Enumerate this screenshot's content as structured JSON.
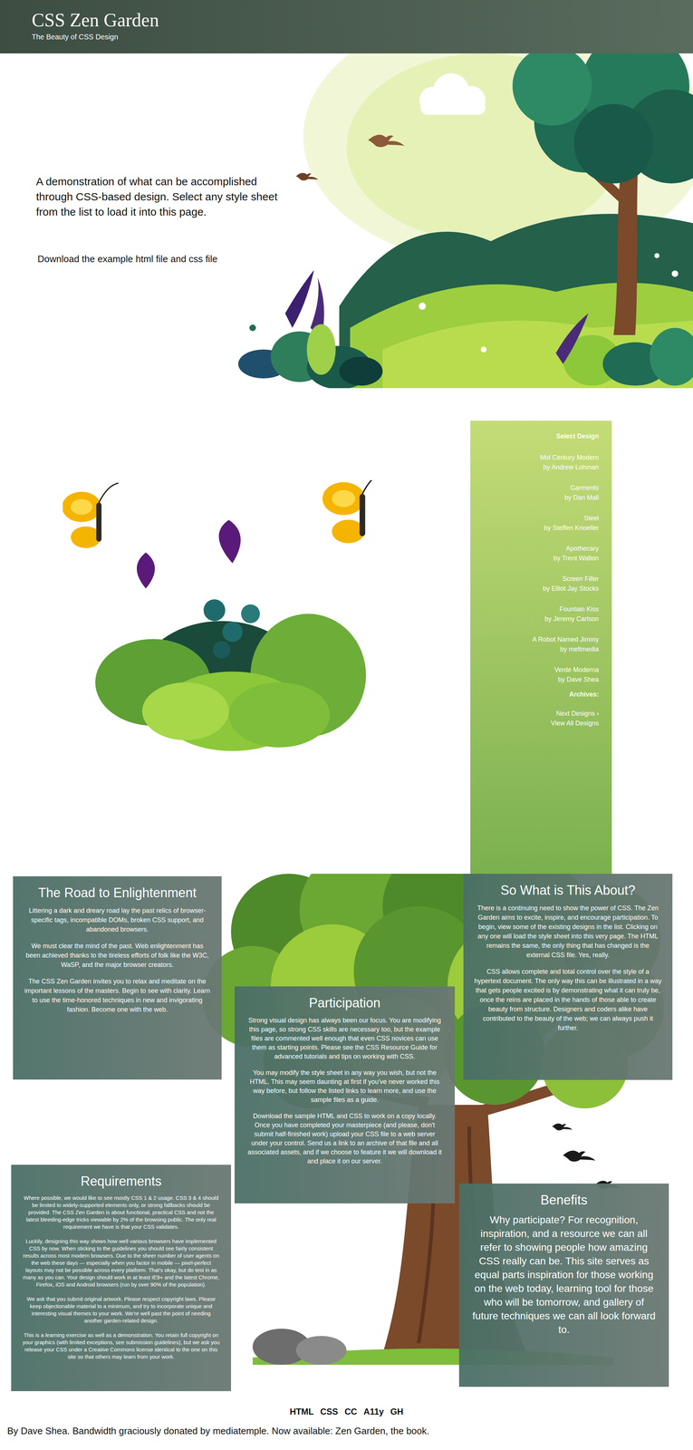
{
  "header": {
    "title": "CSS Zen Garden",
    "subtitle": "The Beauty of CSS Design"
  },
  "intro": {
    "text": "A demonstration of what can be accomplished through CSS-based design. Select any style sheet from the list to load it into this page.",
    "download": "Download the example html file and css file"
  },
  "sidebar": {
    "heading": "Select Design",
    "designs": [
      {
        "name": "Mid Century Modern",
        "author": "by Andrew Lohman"
      },
      {
        "name": "Garments",
        "author": "by Dan Mall"
      },
      {
        "name": "Steel",
        "author": "by Steffen Knoeller"
      },
      {
        "name": "Apothecary",
        "author": "by Trent Walton"
      },
      {
        "name": "Screen Filler",
        "author": "by Elliot Jay Stocks"
      },
      {
        "name": "Fountain Kiss",
        "author": "by Jeremy Carlson"
      },
      {
        "name": "A Robot Named Jimmy",
        "author": "by meltmedia"
      },
      {
        "name": "Verde Moderna",
        "author": "by Dave Shea"
      }
    ],
    "archives_heading": "Archives:",
    "archive_links": [
      "Next Designs ›",
      "View All Designs"
    ]
  },
  "sections": [
    {
      "title": "The Road to Enlightenment",
      "paragraphs": [
        "Littering a dark and dreary road lay the past relics of browser-specific tags, incompatible DOMs, broken CSS support, and abandoned browsers.",
        "We must clear the mind of the past. Web enlightenment has been achieved thanks to the tireless efforts of folk like the W3C, WaSP, and the major browser creators.",
        "The CSS Zen Garden invites you to relax and meditate on the important lessons of the masters. Begin to see with clarity. Learn to use the time-honored techniques in new and invigorating fashion. Become one with the web."
      ]
    },
    {
      "title": "So What is This About?",
      "paragraphs": [
        "There is a continuing need to show the power of CSS. The Zen Garden aims to excite, inspire, and encourage participation. To begin, view some of the existing designs in the list. Clicking on any one will load the style sheet into this very page. The HTML remains the same, the only thing that has changed is the external CSS file. Yes, really.",
        "CSS allows complete and total control over the style of a hypertext document. The only way this can be illustrated in a way that gets people excited is by demonstrating what it can truly be, once the reins are placed in the hands of those able to create beauty from structure. Designers and coders alike have contributed to the beauty of the web; we can always push it further."
      ]
    },
    {
      "title": "Participation",
      "paragraphs": [
        "Strong visual design has always been our focus. You are modifying this page, so strong CSS skills are necessary too, but the example files are commented well enough that even CSS novices can use them as starting points. Please see the CSS Resource Guide for advanced tutorials and tips on working with CSS.",
        "You may modify the style sheet in any way you wish, but not the HTML. This may seem daunting at first if you've never worked this way before, but follow the listed links to learn more, and use the sample files as a guide.",
        "Download the sample HTML and CSS to work on a copy locally. Once you have completed your masterpiece (and please, don't submit half-finished work) upload your CSS file to a web server under your control. Send us a link to an archive of that file and all associated assets, and if we choose to feature it we will download it and place it on our server."
      ]
    },
    {
      "title": "Requirements",
      "paragraphs": [
        "Where possible, we would like to see mostly CSS 1 & 2 usage. CSS 3 & 4 should be limited to widely-supported elements only, or strong fallbacks should be provided. The CSS Zen Garden is about functional, practical CSS and not the latest bleeding-edge tricks viewable by 2% of the browsing public. The only real requirement we have is that your CSS validates.",
        "Luckily, designing this way shows how well various browsers have implemented CSS by now. When sticking to the guidelines you should see fairly consistent results across most modern browsers. Due to the sheer number of user agents on the web these days — especially when you factor in mobile — pixel-perfect layouts may not be possible across every platform. That's okay, but do test in as many as you can. Your design should work in at least IE9+ and the latest Chrome, Firefox, iOS and Android browsers (run by over 90% of the population).",
        "We ask that you submit original artwork. Please respect copyright laws. Please keep objectionable material to a minimum, and try to incorporate unique and interesting visual themes to your work. We're well past the point of needing another garden-related design.",
        "This is a learning exercise as well as a demonstration. You retain full copyright on your graphics (with limited exceptions, see submission guidelines), but we ask you release your CSS under a Creative Commons license identical to the one on this site so that others may learn from your work."
      ]
    },
    {
      "title": "Benefits",
      "paragraphs": [
        "Why participate? For recognition, inspiration, and a resource we can all refer to showing people how amazing CSS really can be. This site serves as equal parts inspiration for those working on the web today, learning tool for those who will be tomorrow, and gallery of future techniques we can all look forward to."
      ]
    }
  ],
  "footer": {
    "links": [
      "HTML",
      "CSS",
      "CC",
      "A11y",
      "GH"
    ],
    "credit": "By Dave Shea. Bandwidth graciously donated by mediatemple. Now available: Zen Garden, the book."
  }
}
